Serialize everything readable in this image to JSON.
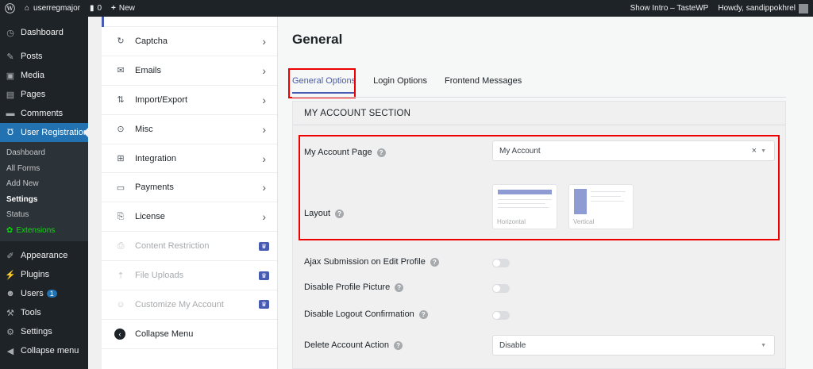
{
  "adminbar": {
    "site_name": "userregmajor",
    "comments_count": "0",
    "new_label": "New",
    "show_intro": "Show Intro – TasteWP",
    "howdy": "Howdy, sandippokhrel"
  },
  "adminmenu": {
    "items_top": [
      {
        "label": "Dashboard",
        "icon": "dashboard-icon"
      },
      {
        "label": "Posts",
        "icon": "pin-icon"
      },
      {
        "label": "Media",
        "icon": "media-icon"
      },
      {
        "label": "Pages",
        "icon": "page-icon"
      },
      {
        "label": "Comments",
        "icon": "comment-icon"
      }
    ],
    "current": "User Registration",
    "submenu": [
      "Dashboard",
      "All Forms",
      "Add New",
      "Settings",
      "Status",
      "Extensions"
    ],
    "items_bottom": [
      {
        "label": "Appearance",
        "icon": "brush-icon"
      },
      {
        "label": "Plugins",
        "icon": "plug-icon"
      },
      {
        "label": "Users",
        "icon": "user-icon",
        "badge": "1"
      },
      {
        "label": "Tools",
        "icon": "wrench-icon"
      },
      {
        "label": "Settings",
        "icon": "settings-icon"
      },
      {
        "label": "Collapse menu",
        "icon": "collapse-icon"
      }
    ]
  },
  "settings_nav": {
    "items": [
      {
        "label": "Captcha",
        "icon": "captcha-icon",
        "type": "chevron"
      },
      {
        "label": "Emails",
        "icon": "mail-icon",
        "type": "chevron"
      },
      {
        "label": "Import/Export",
        "icon": "import-export-icon",
        "type": "chevron"
      },
      {
        "label": "Misc",
        "icon": "misc-icon",
        "type": "chevron"
      },
      {
        "label": "Integration",
        "icon": "integration-icon",
        "type": "chevron"
      },
      {
        "label": "Payments",
        "icon": "card-icon",
        "type": "chevron"
      },
      {
        "label": "License",
        "icon": "license-icon",
        "type": "chevron"
      },
      {
        "label": "Content Restriction",
        "icon": "lock-doc-icon",
        "type": "pro"
      },
      {
        "label": "File Uploads",
        "icon": "upload-icon",
        "type": "pro"
      },
      {
        "label": "Customize My Account",
        "icon": "user-edit-icon",
        "type": "pro"
      },
      {
        "label": "Collapse Menu",
        "icon": "collapse-icon",
        "type": "none"
      }
    ]
  },
  "main": {
    "title": "General",
    "tabs": [
      "General Options",
      "Login Options",
      "Frontend Messages"
    ],
    "section_title": "MY ACCOUNT SECTION",
    "my_account_page_label": "My Account Page",
    "my_account_page_value": "My Account",
    "layout_label": "Layout",
    "layout_options": [
      "Horizontal",
      "Vertical"
    ],
    "ajax_label": "Ajax Submission on Edit Profile",
    "disable_picture_label": "Disable Profile Picture",
    "disable_logout_label": "Disable Logout Confirmation",
    "delete_action_label": "Delete Account Action",
    "delete_action_value": "Disable"
  },
  "colors": {
    "accent": "#475bb2",
    "highlight": "#ee0000",
    "wp_blue": "#2271b1"
  }
}
